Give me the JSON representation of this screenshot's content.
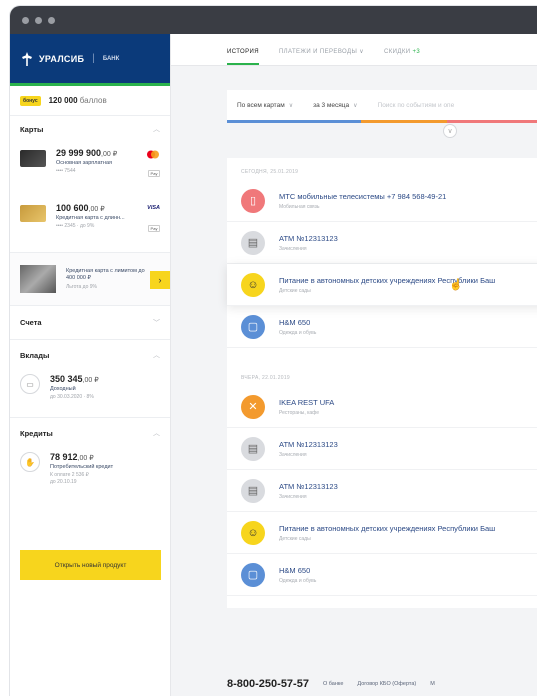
{
  "window": {
    "controls": [
      "close",
      "minimize",
      "maximize"
    ]
  },
  "brand": {
    "name": "УРАЛСИБ",
    "sub": "БАНК"
  },
  "bonus": {
    "tag": "бонус",
    "amount": "120 000",
    "unit": "баллов"
  },
  "sidebar": {
    "cards_title": "Карты",
    "cards": [
      {
        "amount": "29 999 900",
        "cents": ",00 ₽",
        "name": "Основная зарплатная",
        "sub": "•••• 7544",
        "pay": "mastercard"
      },
      {
        "amount": "100 600",
        "cents": ",00 ₽",
        "name": "Кредитная карта с длинн...",
        "sub": "•••• 2345 · до 9%",
        "pay": "VISA"
      }
    ],
    "promo": {
      "line1": "Кредитная карта с лимитом до 400 000 ₽",
      "line2": "Льгота до 9%",
      "arrow": "›"
    },
    "accounts_title": "Счета",
    "deposits_title": "Вклады",
    "deposit": {
      "amount": "350 345",
      "cents": ",00 ₽",
      "name": "Доходный",
      "sub": "до 30.03.2020 · 8%"
    },
    "credits_title": "Кредиты",
    "credit": {
      "amount": "78 912",
      "cents": ",00 ₽",
      "name": "Потребительский кредит",
      "sub1": "К оплате 2 536 ₽",
      "sub2": "до 20.10.19"
    },
    "open_button": "Открыть новый продукт"
  },
  "tabs": [
    {
      "label": "ИСТОРИЯ",
      "active": true
    },
    {
      "label": "ПЛАТЕЖИ И ПЕРЕВОДЫ",
      "suffix": "∨"
    },
    {
      "label": "СКИДКИ",
      "count": "+3"
    }
  ],
  "filters": {
    "cards": "По всем картам",
    "period": "за 3 месяца",
    "search_placeholder": "Поиск по событиям и опе"
  },
  "history": {
    "groups": [
      {
        "date": "СЕГОДНЯ, 25.01.2019",
        "items": [
          {
            "name": "МТС мобильные телесистемы +7 984 568-49-21",
            "category": "Мобильная связь",
            "icon": "phone-icon",
            "color": "#f0787a"
          },
          {
            "name": "ATM №12313123",
            "category": "Зачисления",
            "icon": "atm-icon",
            "color": "#d9dbdf"
          },
          {
            "name": "Питание в автономных детских учреждениях Республики Баш",
            "category": "Детские сады",
            "icon": "kindergarten-icon",
            "color": "#f7d51d",
            "highlight": true
          },
          {
            "name": "H&M 650",
            "category": "Одежда и обувь",
            "icon": "shopping-bag-icon",
            "color": "#5b8fd6"
          }
        ]
      },
      {
        "date": "ВЧЕРА, 22.01.2019",
        "items": [
          {
            "name": "IKEA REST UFA",
            "category": "Рестораны, кафе",
            "icon": "restaurant-icon",
            "color": "#f39a2e"
          },
          {
            "name": "ATM №12313123",
            "category": "Зачисления",
            "icon": "atm-icon",
            "color": "#d9dbdf"
          },
          {
            "name": "ATM №12313123",
            "category": "Зачисления",
            "icon": "atm-icon",
            "color": "#d9dbdf"
          },
          {
            "name": "Питание в автономных детских учреждениях Республики Баш",
            "category": "Детские сады",
            "icon": "kindergarten-icon",
            "color": "#f7d51d"
          },
          {
            "name": "H&M 650",
            "category": "Одежда и обувь",
            "icon": "shopping-bag-icon",
            "color": "#5b8fd6"
          }
        ]
      }
    ]
  },
  "footer": {
    "phone": "8-800-250-57-57",
    "links": [
      "О банке",
      "Договор КБО (Оферта)",
      "М"
    ]
  }
}
